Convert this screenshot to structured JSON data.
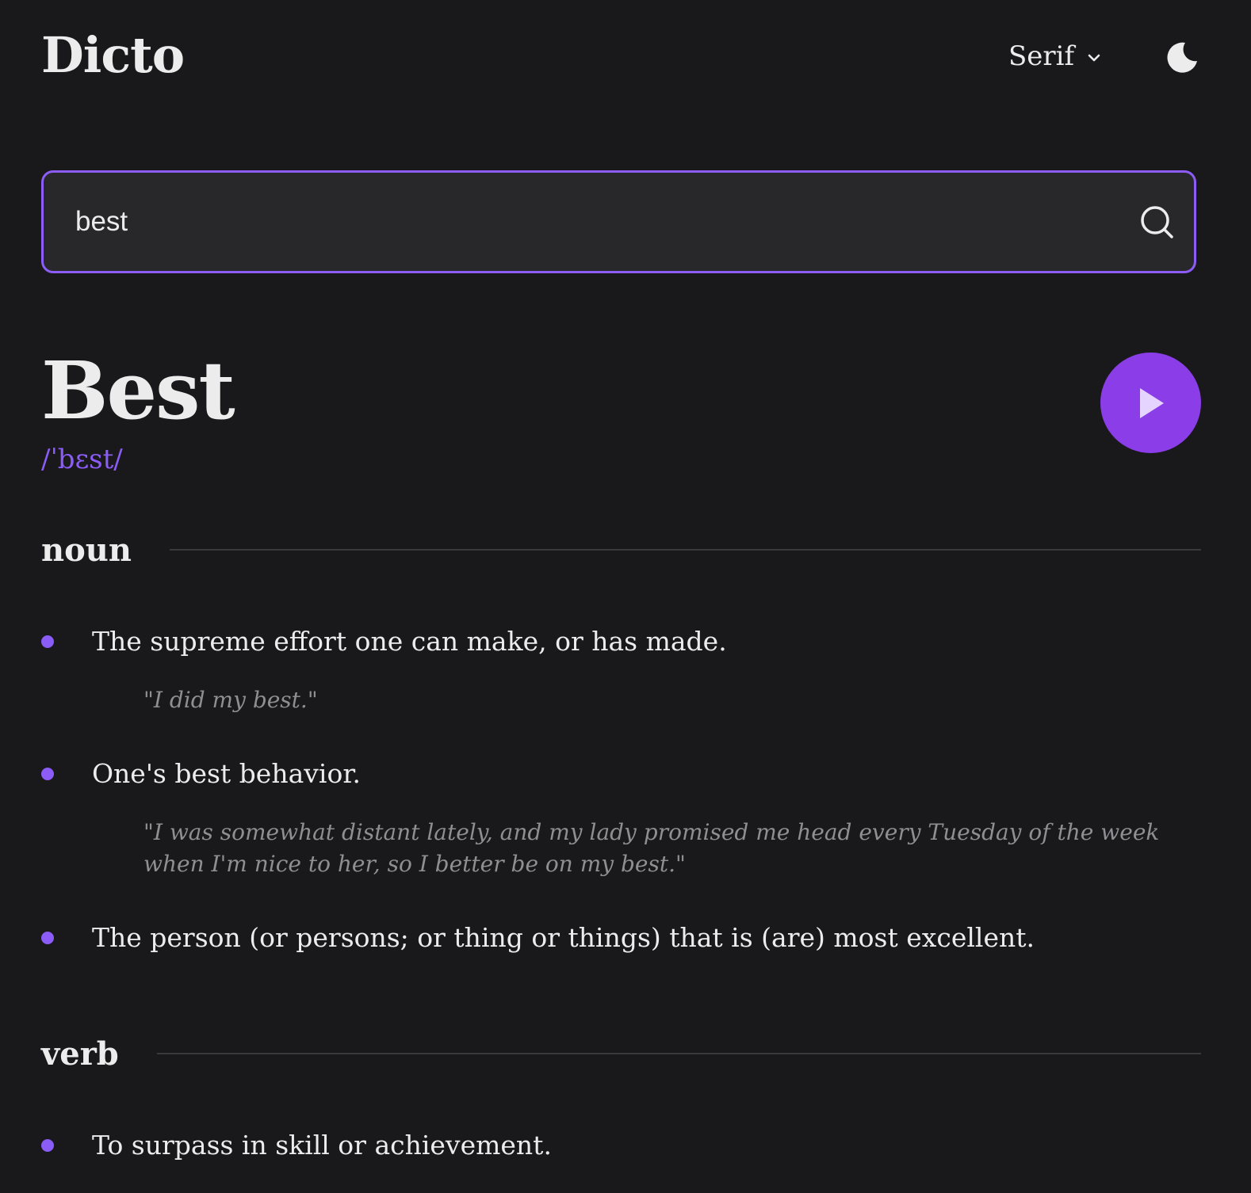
{
  "header": {
    "logo": "Dicto",
    "font_select": {
      "value": "Serif"
    },
    "theme_icon": "moon-icon"
  },
  "search": {
    "value": "best",
    "icon": "search-icon"
  },
  "entry": {
    "word": "Best",
    "phonetic": "/ˈbɛst/",
    "play_icon": "play-icon",
    "meanings": [
      {
        "part_of_speech": "noun",
        "definitions": [
          {
            "text": "The supreme effort one can make, or has made.",
            "example": "\"I did my best.\""
          },
          {
            "text": "One's best behavior.",
            "example": "\"I was somewhat distant lately, and my lady promised me head every Tuesday of the week when I'm nice to her, so I better be on my best.\""
          },
          {
            "text": "The person (or persons; or thing or things) that is (are) most excellent."
          }
        ]
      },
      {
        "part_of_speech": "verb",
        "definitions": [
          {
            "text": "To surpass in skill or achievement."
          }
        ]
      }
    ]
  },
  "colors": {
    "background": "#19191c",
    "accent": "#8b5cf6",
    "play_button": "#8b3de8",
    "text": "#ececec",
    "muted": "#8e8e93"
  }
}
